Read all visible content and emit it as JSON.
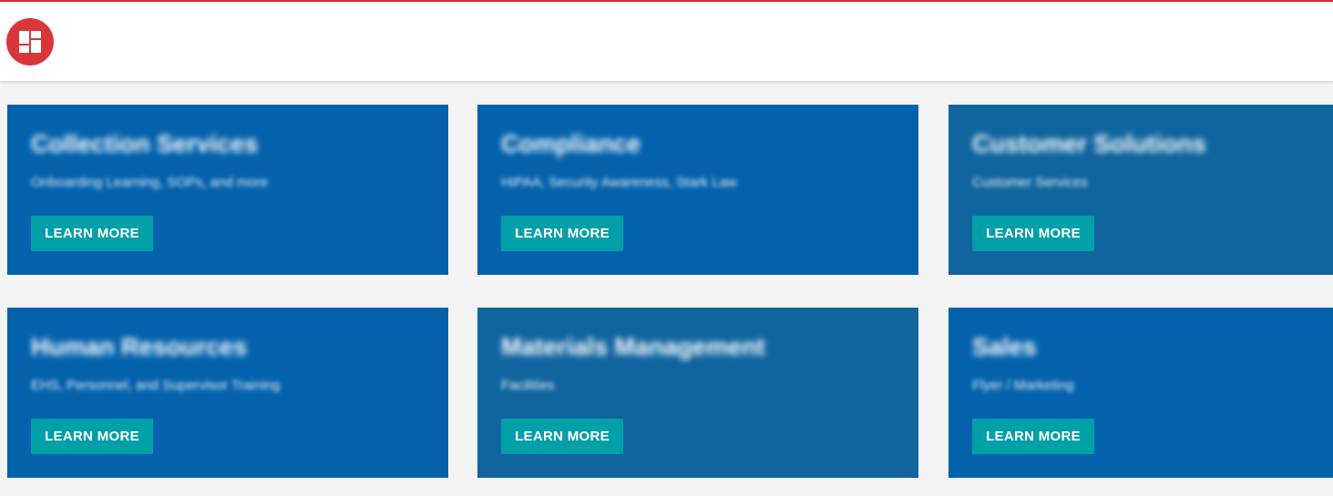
{
  "header": {
    "logo_icon": "dashboard-grid-icon",
    "accent_color": "#d32f2f"
  },
  "cards": [
    {
      "title": "Collection Services",
      "subtitle": "Onboarding Learning, SOPs, and more",
      "button": "LEARN MORE",
      "color": "#0462ac"
    },
    {
      "title": "Compliance",
      "subtitle": "HIPAA, Security Awareness, Stark Law",
      "button": "LEARN MORE",
      "color": "#0462ac"
    },
    {
      "title": "Customer Solutions",
      "subtitle": "Customer Services",
      "button": "LEARN MORE",
      "color": "#11659f"
    },
    {
      "title": "Human Resources",
      "subtitle": "EHS, Personnel, and Supervisor Training",
      "button": "LEARN MORE",
      "color": "#0462ac"
    },
    {
      "title": "Materials Management",
      "subtitle": "Facilities",
      "button": "LEARN MORE",
      "color": "#11659f"
    },
    {
      "title": "Sales",
      "subtitle": "Flyer / Marketing",
      "button": "LEARN MORE",
      "color": "#0462ac"
    }
  ]
}
